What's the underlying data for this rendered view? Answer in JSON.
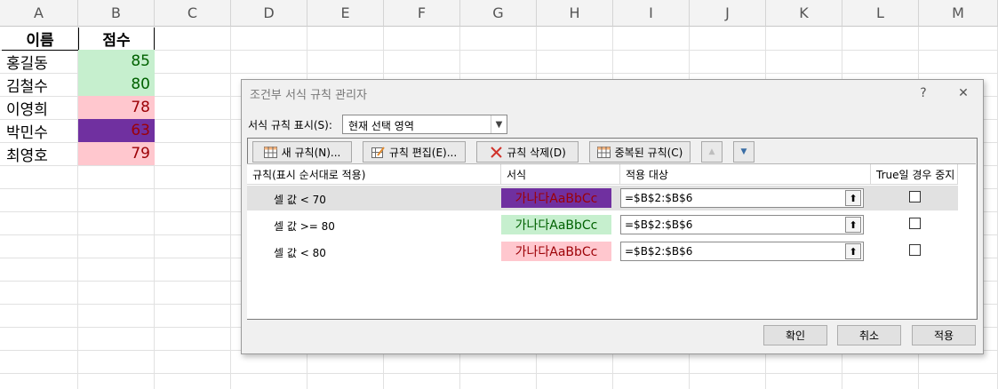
{
  "sheet": {
    "columns": [
      "A",
      "B",
      "C",
      "D",
      "E",
      "F",
      "G",
      "H",
      "I",
      "J",
      "K",
      "L",
      "M"
    ],
    "header": {
      "name": "이름",
      "score": "점수"
    },
    "rows": [
      {
        "name": "홍길동",
        "score": "85",
        "fill": "#c6efce",
        "color": "#006100"
      },
      {
        "name": "김철수",
        "score": "80",
        "fill": "#c6efce",
        "color": "#006100"
      },
      {
        "name": "이영희",
        "score": "78",
        "fill": "#ffc7ce",
        "color": "#9c0006"
      },
      {
        "name": "박민수",
        "score": "63",
        "fill": "#7030a0",
        "color": "#9c0006"
      },
      {
        "name": "최영호",
        "score": "79",
        "fill": "#ffc7ce",
        "color": "#9c0006"
      }
    ]
  },
  "dialog": {
    "title": "조건부 서식 규칙 관리자",
    "help_label": "?",
    "close_label": "✕",
    "show_rules_label": "서식 규칙 표시(S):",
    "show_rules_value": "현재 선택 영역",
    "toolbar": {
      "new_rule": "새 규칙(N)...",
      "edit_rule": "규칙 편집(E)...",
      "delete_rule": "규칙 삭제(D)",
      "duplicate_rule": "중복된 규칙(C)",
      "move_up": "▲",
      "move_down": "▼"
    },
    "table_headers": {
      "rule": "규칙(표시 순서대로 적용)",
      "format": "서식",
      "applies_to": "적용 대상",
      "stop_if_true": "True일 경우 중지"
    },
    "rules": [
      {
        "condition": "셀 값 < 70",
        "preview": "가나다AaBbCc",
        "preview_bg": "#7030a0",
        "preview_color": "#9c0006",
        "applies_to": "=$B$2:$B$6",
        "stop": false,
        "selected": true
      },
      {
        "condition": "셀 값 >= 80",
        "preview": "가나다AaBbCc",
        "preview_bg": "#c6efce",
        "preview_color": "#006100",
        "applies_to": "=$B$2:$B$6",
        "stop": false,
        "selected": false
      },
      {
        "condition": "셀 값 < 80",
        "preview": "가나다AaBbCc",
        "preview_bg": "#ffc7ce",
        "preview_color": "#9c0006",
        "applies_to": "=$B$2:$B$6",
        "stop": false,
        "selected": false
      }
    ],
    "buttons": {
      "ok": "확인",
      "cancel": "취소",
      "apply": "적용"
    }
  }
}
